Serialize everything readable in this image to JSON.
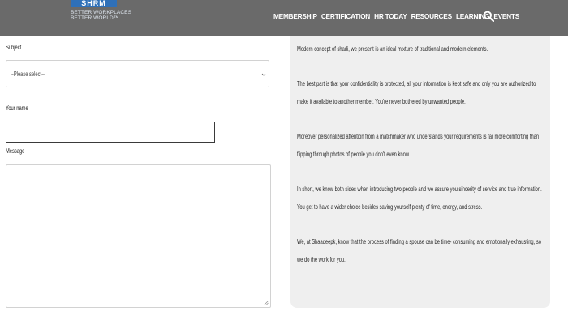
{
  "header": {
    "logo": {
      "name": "SHRM",
      "tagline_line1": "BETTER WORKPLACES",
      "tagline_line2": "BETTER WORLD™"
    },
    "nav": [
      "MEMBERSHIP",
      "CERTIFICATION",
      "HR TODAY",
      "RESOURCES",
      "LEARNING",
      "EVENTS"
    ],
    "search_icon": "search-icon",
    "background": "#6a6a6a"
  },
  "form": {
    "subject_label": "Subject",
    "subject_selected": "--Please select--",
    "name_label": "Your name",
    "name_value": "",
    "message_label": "Message",
    "message_value": ""
  },
  "info": {
    "paragraphs": [
      "Modern concept of shadi, we present is an ideal mixture of traditional and modern elements.",
      "The best part is that your confidentiality is protected, all your information is kept safe and only you are authorized to make it available to another member. You're never bothered by unwanted people.",
      "Moreover personalized attention from a matchmaker who understands your requirements is far more comforting than flipping through photos of people you don't even know.",
      "In short, we know both sides when introducing two people and we assure you sincerity of service and true information. You get to have a wider choice besides saving yourself plenty of time, energy, and stress.",
      "We, at Shaadeepk, know that the process of finding a spouse can be time- consuming and emotionally exhausting, so we do the work for you."
    ],
    "panel_color": "#efefef"
  }
}
